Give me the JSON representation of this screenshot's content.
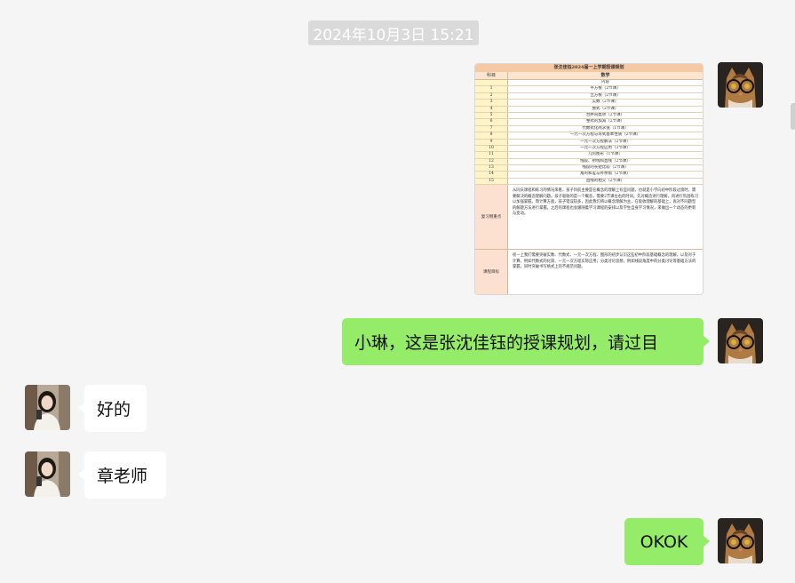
{
  "timestamp": "2024年10月3日 15:21",
  "document": {
    "title": "张沈佳钰2024届一上学期授课规划",
    "col_header_1": "科目",
    "col_header_2": "数学",
    "section_label": "内容",
    "rows": [
      {
        "n": "1",
        "t": "平方根（2节课）"
      },
      {
        "n": "2",
        "t": "立方根（2节课）"
      },
      {
        "n": "3",
        "t": "实数（2节课）"
      },
      {
        "n": "4",
        "t": "整式（2节课）"
      },
      {
        "n": "5",
        "t": "合并同类项（2节课）"
      },
      {
        "n": "6",
        "t": "整式的加减（2节课）"
      },
      {
        "n": "7",
        "t": "代数式化简求值（1节课）"
      },
      {
        "n": "8",
        "t": "一元一次方程与等式基本性质（2节课）"
      },
      {
        "n": "9",
        "t": "一元一次方程解法（2节课）"
      },
      {
        "n": "10",
        "t": "一元一次方程应用（3节课）"
      },
      {
        "n": "11",
        "t": "几何图形（1节课）"
      },
      {
        "n": "12",
        "t": "线段、射线和直线（2节课）"
      },
      {
        "n": "13",
        "t": "线段的长短比较（2节课）"
      },
      {
        "n": "14",
        "t": "角的和差与补余角（2节课）"
      },
      {
        "n": "15",
        "t": "直线的相交（2节课）"
      }
    ],
    "review_label": "复习侧重点",
    "review_text": "从同庆课程和练习的情况来看，孩子目前主要是在概念的理解上有些问题，也就是小学向初中阶段过渡时，需要解决的概念理解问题。孩子吸收的是一个概念，需要2节课左右的时间。先对概念进行理解，再进行巩固练习以加强掌握。而计算方面，孩子错误较多，因此我们将以概念理解为主，在吸收理解的基础上，再对不同题型的解题方法进行掌握。之后的课程也会跟随着学习课程的安排以及学生自身学习情况，来做出一个动态的更新与变动。",
    "goal_label": "课程目标",
    "goal_text": "初一上我们需要突破实数、代数式、一元一次方程、图形的初步认识这些初中阶段基础概念的理解，以及对于计算，例如代数式的化简、一元一次方程实际应用；分类讨论思想，例如线段角度中的分类讨论等基础方法的掌握，同时突破书写格式上的不规范问题。"
  },
  "messages": [
    {
      "sender": "me",
      "text": "小琳，这是张沈佳钰的授课规划，请过目"
    },
    {
      "sender": "other",
      "text": "好的"
    },
    {
      "sender": "other",
      "text": "章老师"
    },
    {
      "sender": "me",
      "text": "OKOK"
    }
  ],
  "colors": {
    "background": "#f5f5f5",
    "my_bubble": "#95ec69",
    "other_bubble": "#ffffff",
    "timestamp_bg": "#dadada"
  }
}
